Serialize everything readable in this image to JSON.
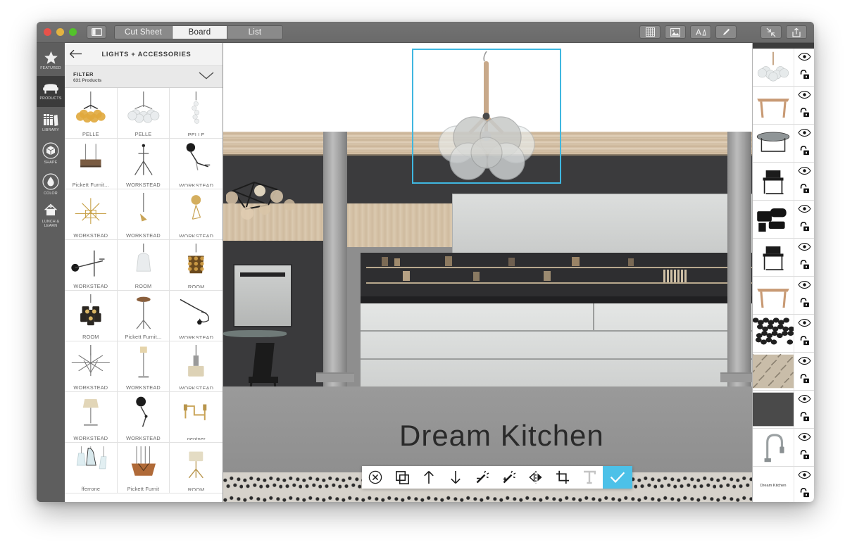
{
  "window": {
    "traffic_lights": [
      "close",
      "minimize",
      "maximize"
    ],
    "sidebar_toggle_icon": "sidebar-toggle-icon",
    "tabs": [
      {
        "label": "Cut Sheet",
        "active": false
      },
      {
        "label": "Board",
        "active": true
      },
      {
        "label": "List",
        "active": false
      }
    ],
    "toolbar_right": [
      {
        "icon": "grid-icon"
      },
      {
        "icon": "image-icon"
      },
      {
        "icon": "text-tool-icon"
      },
      {
        "icon": "pen-icon"
      },
      {
        "icon": "collapse-icon"
      },
      {
        "icon": "share-icon"
      }
    ]
  },
  "rail": {
    "items": [
      {
        "label": "FEATURED",
        "icon": "star-icon",
        "active": false
      },
      {
        "label": "PRODUCTS",
        "icon": "sofa-icon",
        "active": true
      },
      {
        "label": "LIBRARY",
        "icon": "books-icon",
        "active": false
      },
      {
        "label": "SHAPE",
        "icon": "cube-icon",
        "active": false
      },
      {
        "label": "COLOR",
        "icon": "droplet-icon",
        "active": false
      },
      {
        "label": "LUNCH &\nLEARN",
        "icon": "lunch-learn-icon",
        "active": false
      }
    ]
  },
  "products_panel": {
    "back_icon": "back-arrow-icon",
    "title": "LIGHTS + ACCESSORIES",
    "filter": {
      "label": "FILTER",
      "count": "631 Products",
      "chevron_icon": "chevron-down-icon"
    },
    "items": [
      {
        "label": "PELLE",
        "art": "chandelier-gold"
      },
      {
        "label": "PELLE",
        "art": "chandelier-bubble"
      },
      {
        "label": "PELLE",
        "art": "pendant-thin"
      },
      {
        "label": "Pickett Furnit...",
        "art": "linear-pendant"
      },
      {
        "label": "WORKSTEAD",
        "art": "tripod-lamp"
      },
      {
        "label": "WORKSTEAD",
        "art": "arm-sconce-black"
      },
      {
        "label": "WORKSTEAD",
        "art": "multi-arm-brass"
      },
      {
        "label": "WORKSTEAD",
        "art": "pendant-brass"
      },
      {
        "label": "WORKSTEAD",
        "art": "globe-sconce-brass"
      },
      {
        "label": "WORKSTEAD",
        "art": "arm-sconce-long"
      },
      {
        "label": "ROOM",
        "art": "glass-pendant"
      },
      {
        "label": "ROOM",
        "art": "amber-pendant"
      },
      {
        "label": "ROOM",
        "art": "cluster-pendant"
      },
      {
        "label": "Pickett Furnit...",
        "art": "floor-lamp-wood"
      },
      {
        "label": "WORKSTEAD",
        "art": "desk-lamp"
      },
      {
        "label": "WORKSTEAD",
        "art": "multi-arm-silver"
      },
      {
        "label": "WORKSTEAD",
        "art": "floor-lamp-slim"
      },
      {
        "label": "WORKSTEAD",
        "art": "drum-pendant"
      },
      {
        "label": "WORKSTEAD",
        "art": "table-lamp-shade"
      },
      {
        "label": "WORKSTEAD",
        "art": "ball-sconce-black"
      },
      {
        "label": "gentner",
        "art": "brass-bar-sconce"
      },
      {
        "label": "fferrone",
        "art": "glass-trio"
      },
      {
        "label": "Pickett Furnit",
        "art": "copper-bowl"
      },
      {
        "label": "ROOM",
        "art": "tripod-table-lamp"
      }
    ]
  },
  "canvas": {
    "selected_item": "chandelier-bubble-large",
    "selection_color": "#3fb7e0",
    "title_text": "Dream  Kitchen"
  },
  "bottom_toolbar": {
    "buttons": [
      {
        "icon": "close-circle-icon",
        "state": "enabled"
      },
      {
        "icon": "duplicate-icon",
        "state": "enabled"
      },
      {
        "icon": "arrow-up-icon",
        "state": "enabled"
      },
      {
        "icon": "arrow-down-icon",
        "state": "enabled"
      },
      {
        "icon": "magic-wand-minus-icon",
        "state": "enabled"
      },
      {
        "icon": "magic-wand-plus-icon",
        "state": "enabled"
      },
      {
        "icon": "flip-horizontal-icon",
        "state": "enabled"
      },
      {
        "icon": "crop-icon",
        "state": "enabled"
      },
      {
        "icon": "text-icon",
        "state": "disabled"
      },
      {
        "icon": "checkmark-icon",
        "state": "confirm"
      }
    ],
    "confirm_color": "#4cc1e8"
  },
  "layers_panel": {
    "visibility_icon": "eye-icon",
    "lock_icon": "unlock-icon",
    "layers": [
      {
        "art": "chandelier-bubble-large",
        "label": ""
      },
      {
        "art": "console-table-wood",
        "label": ""
      },
      {
        "art": "round-table-dark",
        "label": ""
      },
      {
        "art": "chair-black",
        "label": ""
      },
      {
        "art": "chair-black-cluster",
        "label": ""
      },
      {
        "art": "chair-black-2",
        "label": ""
      },
      {
        "art": "console-table-wood-2",
        "label": ""
      },
      {
        "art": "pebble-swatch",
        "label": ""
      },
      {
        "art": "terrazzo-swatch",
        "label": ""
      },
      {
        "art": "dark-grey-swatch",
        "label": ""
      },
      {
        "art": "faucet",
        "label": ""
      },
      {
        "art": "text-layer",
        "label": "Dream  Kitchen"
      }
    ]
  }
}
